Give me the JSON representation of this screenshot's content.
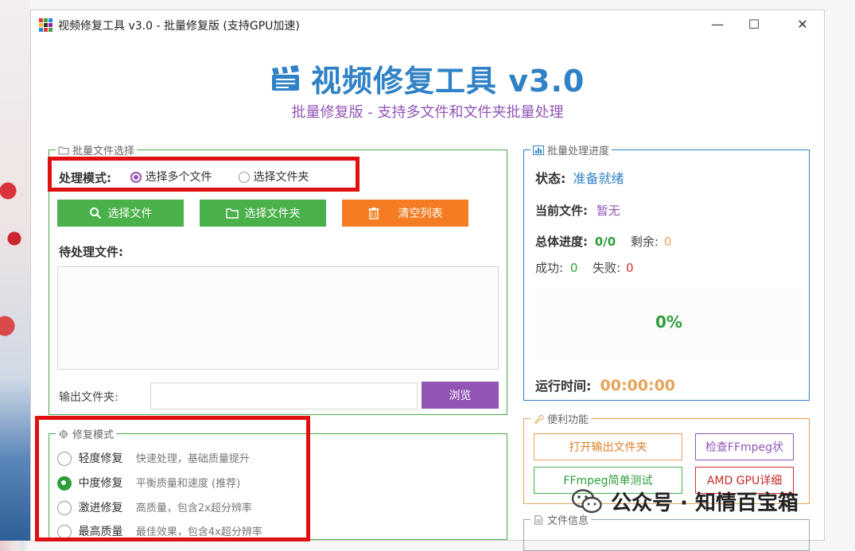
{
  "window": {
    "title": "视频修复工具 v3.0 - 批量修复版 (支持GPU加速)",
    "controls": {
      "minimize": "—",
      "maximize": "☐",
      "close": "✕"
    }
  },
  "header": {
    "title": "视频修复工具 v3.0",
    "subtitle": "批量修复版 - 支持多文件和文件夹批量处理"
  },
  "file_selection": {
    "legend": "批量文件选择",
    "mode_label": "处理模式:",
    "mode_options": [
      {
        "label": "选择多个文件",
        "selected": true
      },
      {
        "label": "选择文件夹",
        "selected": false
      }
    ],
    "buttons": {
      "select_files": "选择文件",
      "select_folder": "选择文件夹",
      "clear_list": "清空列表"
    },
    "pending_label": "待处理文件:",
    "output_label": "输出文件夹:",
    "output_value": "",
    "browse_button": "浏览"
  },
  "repair_mode": {
    "legend": "修复模式",
    "options": [
      {
        "name": "轻度修复",
        "desc": "快速处理，基础质量提升",
        "selected": false
      },
      {
        "name": "中度修复",
        "desc": "平衡质量和速度 (推荐)",
        "selected": true
      },
      {
        "name": "激进修复",
        "desc": "高质量，包含2x超分辨率",
        "selected": false
      },
      {
        "name": "最高质量",
        "desc": "最佳效果，包含4x超分辨率",
        "selected": false
      }
    ]
  },
  "progress": {
    "legend": "批量处理进度",
    "status_label": "状态:",
    "status_value": "准备就绪",
    "current_file_label": "当前文件:",
    "current_file_value": "暂无",
    "total_label": "总体进度:",
    "total_value": "0/0",
    "remaining_label": "剩余:",
    "remaining_value": "0",
    "success_label": "成功:",
    "success_value": "0",
    "fail_label": "失败:",
    "fail_value": "0",
    "percent": "0%",
    "runtime_label": "运行时间:",
    "runtime_value": "00:00:00"
  },
  "utilities": {
    "legend": "便利功能",
    "open_output": "打开输出文件夹",
    "check_ffmpeg": "检查FFmpeg状",
    "ffmpeg_test": "FFmpeg简单测试",
    "amd_gpu": "AMD GPU详细"
  },
  "file_info": {
    "legend": "文件信息"
  },
  "watermark": {
    "text": "公众号 · 知情百宝箱"
  },
  "colors": {
    "accent_blue": "#2f82c6",
    "accent_purple": "#9255b6",
    "green": "#4ab04a",
    "orange": "#f57c22",
    "highlight_red": "#e01010"
  }
}
